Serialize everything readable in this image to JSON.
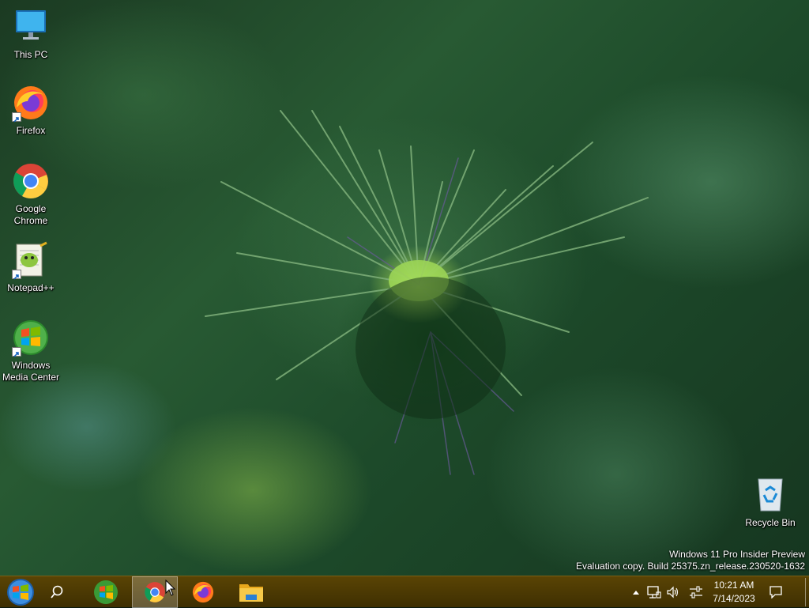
{
  "desktop": {
    "icons": [
      {
        "label": "This PC",
        "icon": "computer-monitor-icon"
      },
      {
        "label": "Firefox",
        "icon": "firefox-icon"
      },
      {
        "label": "Google Chrome",
        "icon": "chrome-icon"
      },
      {
        "label": "Notepad++",
        "icon": "notepadpp-icon"
      },
      {
        "label": "Windows Media Center",
        "icon": "windows-media-center-icon"
      },
      {
        "label": "Recycle Bin",
        "icon": "recycle-bin-icon"
      }
    ],
    "watermark": {
      "line1": "Windows 11 Pro Insider Preview",
      "line2": "Evaluation copy. Build 25375.zn_release.230520-1632"
    }
  },
  "taskbar": {
    "apps": [
      "start-orb",
      "search",
      "windows-media-center",
      "chrome",
      "firefox",
      "file-explorer"
    ],
    "active_app": "chrome",
    "tray": {
      "time": "10:21 AM",
      "date": "7/14/2023"
    }
  },
  "colors": {
    "taskbar": "#4a3903",
    "accent": "#0a7bd6"
  }
}
